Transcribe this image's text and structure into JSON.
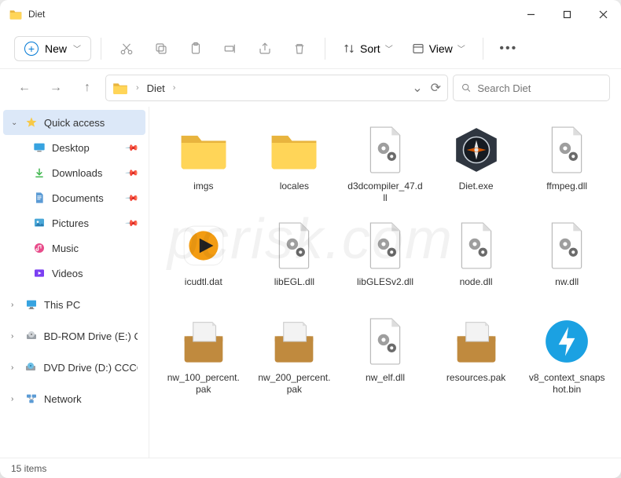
{
  "window": {
    "title": "Diet"
  },
  "toolbar": {
    "new_label": "New",
    "sort_label": "Sort",
    "view_label": "View"
  },
  "address": {
    "crumb": "Diet"
  },
  "search": {
    "placeholder": "Search Diet"
  },
  "sidebar": {
    "quick_access": "Quick access",
    "desktop": "Desktop",
    "downloads": "Downloads",
    "documents": "Documents",
    "pictures": "Pictures",
    "music": "Music",
    "videos": "Videos",
    "this_pc": "This PC",
    "bdrom": "BD-ROM Drive (E:) C",
    "dvd": "DVD Drive (D:) CCCC",
    "network": "Network"
  },
  "files": {
    "f0": "imgs",
    "f1": "locales",
    "f2": "d3dcompiler_47.dll",
    "f3": "Diet.exe",
    "f4": "ffmpeg.dll",
    "f5": "icudtl.dat",
    "f6": "libEGL.dll",
    "f7": "libGLESv2.dll",
    "f8": "node.dll",
    "f9": "nw.dll",
    "f10": "nw_100_percent.pak",
    "f11": "nw_200_percent.pak",
    "f12": "nw_elf.dll",
    "f13": "resources.pak",
    "f14": "v8_context_snapshot.bin"
  },
  "status": {
    "text": "15 items"
  }
}
